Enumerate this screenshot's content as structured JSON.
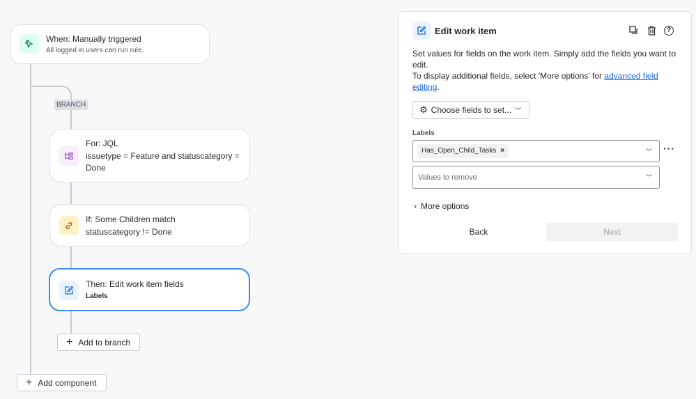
{
  "flow": {
    "trigger": {
      "title": "When: Manually triggered",
      "subtitle": "All logged in users can run rule."
    },
    "branch_label": "BRANCH",
    "for_node": {
      "title": "For: JQL",
      "body": "issuetype = Feature and statuscategory = Done"
    },
    "if_node": {
      "title": "If: Some Children match",
      "body": "statuscategory != Done"
    },
    "then_node": {
      "title": "Then: Edit work item fields",
      "subtitle": "Labels"
    },
    "add_to_branch": "Add to branch",
    "add_component": "Add component"
  },
  "panel": {
    "title": "Edit work item",
    "description_1": "Set values for fields on the work item. Simply add the fields you want to edit.",
    "description_2_prefix": "To display additional fields, select 'More options' for ",
    "description_2_link": "advanced field editing",
    "description_2_suffix": ".",
    "choose_fields": "Choose fields to set...",
    "labels_heading": "Labels",
    "label_tag": "Has_Open_Child_Tasks",
    "remove_placeholder": "Values to remove",
    "more_options": "More options",
    "back": "Back",
    "next": "Next"
  },
  "colors": {
    "accent": "#1868db",
    "selected_border": "#388bff"
  }
}
